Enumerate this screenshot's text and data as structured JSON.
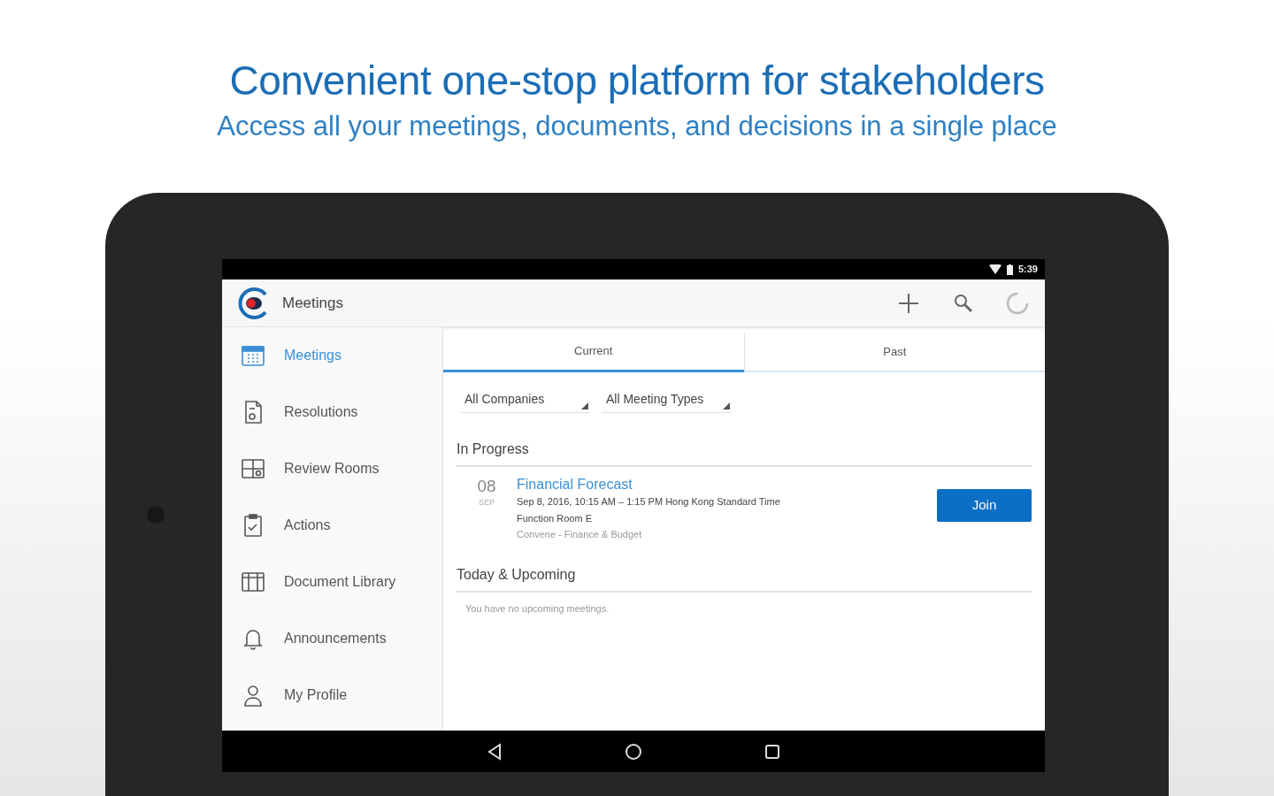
{
  "headline": "Convenient one-stop platform for stakeholders",
  "subheadline": "Access all your meetings, documents, and decisions in a single place",
  "status_bar": {
    "time": "5:39"
  },
  "app_bar": {
    "title": "Meetings"
  },
  "sidebar": {
    "items": [
      {
        "label": "Meetings",
        "selected": true
      },
      {
        "label": "Resolutions",
        "selected": false
      },
      {
        "label": "Review Rooms",
        "selected": false
      },
      {
        "label": "Actions",
        "selected": false
      },
      {
        "label": "Document Library",
        "selected": false
      },
      {
        "label": "Announcements",
        "selected": false
      },
      {
        "label": "My Profile",
        "selected": false
      }
    ]
  },
  "tabs": [
    {
      "label": "Current",
      "selected": true
    },
    {
      "label": "Past",
      "selected": false
    }
  ],
  "filters": [
    {
      "value": "All Companies"
    },
    {
      "value": "All Meeting Types"
    }
  ],
  "in_progress": {
    "heading": "In Progress",
    "meetings": [
      {
        "day": "08",
        "month": "SEP",
        "title": "Financial Forecast",
        "time": "Sep 8, 2016, 10:15 AM – 1:15 PM Hong Kong Standard Time",
        "location": "Function Room E",
        "group": "Convene - Finance & Budget",
        "action": "Join"
      }
    ]
  },
  "upcoming": {
    "heading": "Today & Upcoming",
    "empty_text": "You have no upcoming meetings."
  }
}
